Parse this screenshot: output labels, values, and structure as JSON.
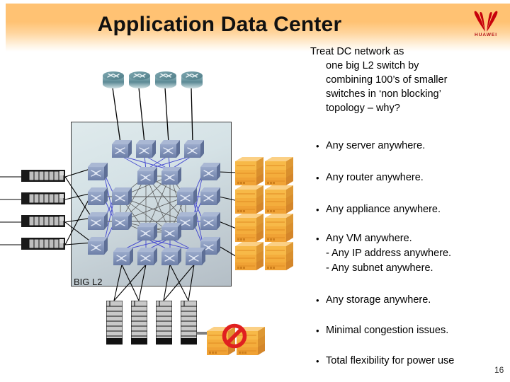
{
  "header": {
    "title": "Application Data Center",
    "logo": {
      "name": "huawei-logo",
      "wordmark": "HUAWEI",
      "color": "#c7000b"
    },
    "band_color_top": "#ffc273",
    "band_color_bottom": "#ffffff"
  },
  "intro": {
    "line1": "Treat DC network as",
    "line2": "one big L2 switch by",
    "line3": "combining 100’s of smaller",
    "line4": "switches in ‘non blocking’",
    "line5": "topology – why?"
  },
  "bullets": [
    {
      "marker": "•",
      "text": "Any server anywhere.",
      "subs": []
    },
    {
      "marker": "•",
      "text": "Any router anywhere.",
      "subs": []
    },
    {
      "marker": "•",
      "text": "Any appliance anywhere.",
      "subs": []
    },
    {
      "marker": "•",
      "text": "Any VM anywhere.",
      "subs": [
        "- Any IP address anywhere.",
        "- Any subnet anywhere."
      ]
    },
    {
      "marker": "•",
      "text": "Any storage anywhere.",
      "subs": []
    },
    {
      "marker": "•",
      "text": "Minimal congestion issues.",
      "subs": []
    },
    {
      "marker": "•",
      "text": "Total flexibility for power use",
      "subs": []
    }
  ],
  "diagram": {
    "boundary_label": "BIG L2",
    "boundary_border_color": "#3a3a3a",
    "boundary_fill_top": "#dfeaec",
    "boundary_fill_bottom": "#b4bec6",
    "link_color_core": "#4a4fd0",
    "link_color_mesh": "#555555",
    "link_color_edge": "#000000",
    "routers": {
      "icon": "router-icon",
      "count": 4,
      "color": "#4e7e88"
    },
    "switches": {
      "icon": "switch-icon",
      "count": 26,
      "color": "#7b8db5"
    },
    "storage_units": {
      "icon": "storage-stack-icon",
      "count": 8,
      "color": "#f0a830"
    },
    "blade_chassis": {
      "icon": "blade-chassis-icon",
      "count": 4,
      "color": "#c8c8c8"
    },
    "server_racks": {
      "icon": "server-rack-icon",
      "count": 4,
      "color": "#cccccc"
    },
    "blocked_storage": {
      "icon": "no-entry-icon",
      "count": 2,
      "badge_color": "#e02020"
    }
  },
  "footer": {
    "slide_number": "16"
  }
}
